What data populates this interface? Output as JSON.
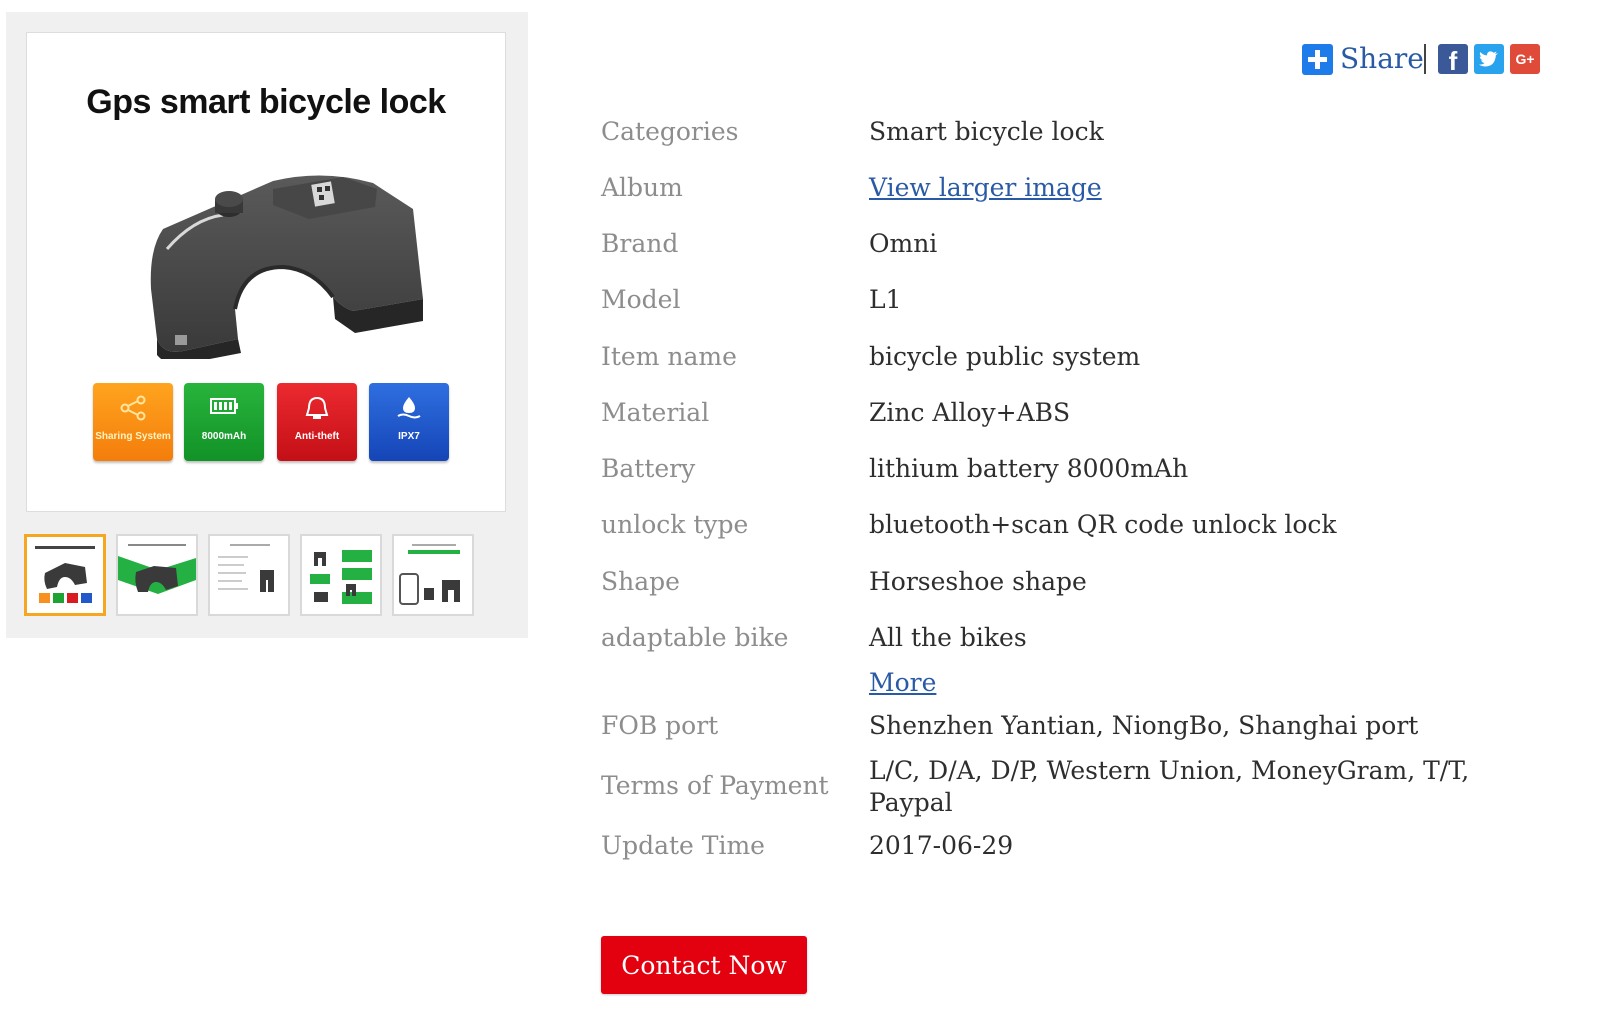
{
  "gallery": {
    "main_image": {
      "title": "Gps smart bicycle lock",
      "badges": [
        {
          "label": "Sharing System",
          "icon": "share-icon",
          "color": "#f7901e"
        },
        {
          "label": "8000mAh",
          "icon": "battery-icon",
          "color": "#1ea332"
        },
        {
          "label": "Anti-theft",
          "icon": "alarm-icon",
          "color": "#d91b22"
        },
        {
          "label": "IPX7",
          "icon": "water-icon",
          "color": "#2258c9"
        }
      ]
    },
    "thumbnails_count": 5,
    "selected_thumbnail": 1
  },
  "share": {
    "label": "Share",
    "networks": [
      {
        "name": "facebook-icon",
        "color": "#3b5998"
      },
      {
        "name": "twitter-icon",
        "color": "#2aa3ef"
      },
      {
        "name": "google-plus-icon",
        "color": "#e04a39"
      }
    ]
  },
  "specs": [
    {
      "label": "Categories",
      "value": "Smart bicycle lock"
    },
    {
      "label": "Album",
      "value": "View larger image"
    },
    {
      "label": "Brand",
      "value": "Omni"
    },
    {
      "label": "Model",
      "value": "L1"
    },
    {
      "label": "Item name",
      "value": "bicycle public system"
    },
    {
      "label": "Material",
      "value": "Zinc Alloy+ABS"
    },
    {
      "label": "Battery",
      "value": "lithium battery 8000mAh"
    },
    {
      "label": "unlock type",
      "value": "bluetooth+scan QR code unlock lock"
    },
    {
      "label": "Shape",
      "value": "Horseshoe shape"
    },
    {
      "label": "adaptable bike",
      "value": "All the bikes"
    },
    {
      "label": "FOB port",
      "value": "Shenzhen Yantian, NiongBo, Shanghai port"
    },
    {
      "label": "Terms of Payment",
      "value": "L/C, D/A, D/P, Western Union, MoneyGram, T/T, Paypal"
    },
    {
      "label": "Update Time",
      "value": "2017-06-29"
    }
  ],
  "more_link": "More",
  "contact_button": "Contact Now",
  "colors": {
    "accent_red": "#e3000f",
    "link_blue": "#2a5aa6",
    "label_gray": "#8d8d8d",
    "thumb_selected": "#f5a623"
  }
}
